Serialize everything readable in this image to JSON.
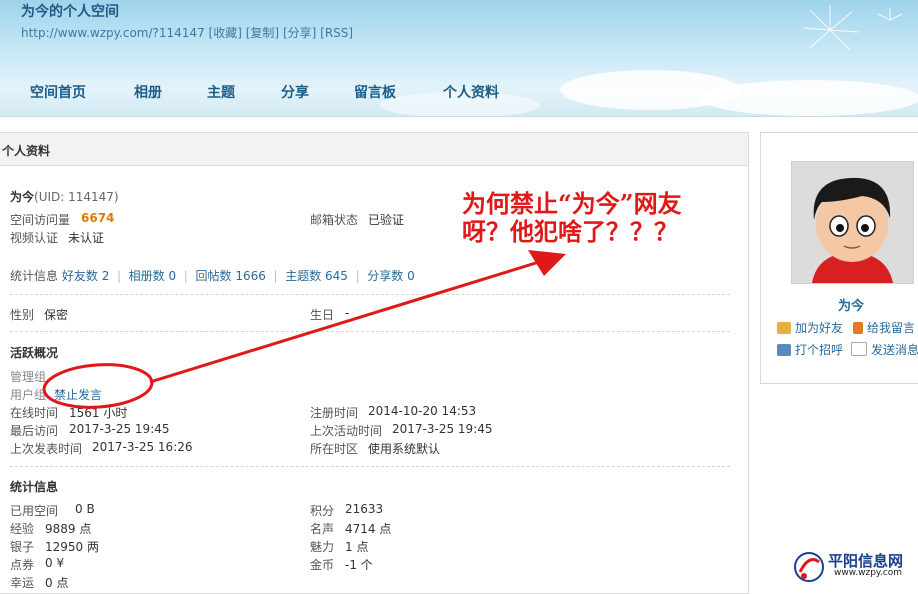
{
  "header": {
    "title": "为今的个人空间",
    "url": "http://www.wzpy.com/?114147",
    "links": [
      "[收藏]",
      "[复制]",
      "[分享]",
      "[RSS]"
    ]
  },
  "nav": [
    "空间首页",
    "相册",
    "主题",
    "分享",
    "留言板",
    "个人资料"
  ],
  "panel": {
    "title": "个人资料",
    "user_name": "为今",
    "uid": "(UID: 114147)",
    "visits_label": "空间访问量",
    "visits_value": "6674",
    "email_label": "邮箱状态",
    "email_value": "已验证",
    "video_label": "视频认证",
    "video_value": "未认证",
    "stats_label": "统计信息",
    "stats": [
      {
        "label": "好友数",
        "value": "2"
      },
      {
        "label": "相册数",
        "value": "0"
      },
      {
        "label": "回帖数",
        "value": "1666"
      },
      {
        "label": "主题数",
        "value": "645"
      },
      {
        "label": "分享数",
        "value": "0"
      }
    ],
    "gender_label": "性别",
    "gender_value": "保密",
    "birthday_label": "生日",
    "birthday_value": "-",
    "activity_title": "活跃概况",
    "admin_group_label": "管理组",
    "user_group_label": "用户组",
    "user_group_value": "禁止发言",
    "online_label": "在线时间",
    "online_value": "1561 小时",
    "reg_label": "注册时间",
    "reg_value": "2014-10-20 14:53",
    "last_visit_label": "最后访问",
    "last_visit_value": "2017-3-25 19:45",
    "last_active_label": "上次活动时间",
    "last_active_value": "2017-3-25 19:45",
    "last_post_label": "上次发表时间",
    "last_post_value": "2017-3-25 16:26",
    "tz_label": "所在时区",
    "tz_value": "使用系统默认",
    "statistics_title": "统计信息",
    "used_space_label": "已用空间",
    "used_space_value": "0 B",
    "points_label": "积分",
    "points_value": "21633",
    "exp_label": "经验",
    "exp_value": "9889 点",
    "fame_label": "名声",
    "fame_value": "4714 点",
    "silver_label": "银子",
    "silver_value": "12950 两",
    "charm_label": "魅力",
    "charm_value": "1 点",
    "coupon_label": "点券",
    "coupon_value": "0 ¥",
    "gold_label": "金币",
    "gold_value": "-1 个",
    "luck_label": "幸运",
    "luck_value": "0 点"
  },
  "sidebar": {
    "name": "为今",
    "add_friend": "加为好友",
    "leave_message": "给我留言",
    "greet": "打个招呼",
    "send_message": "发送消息"
  },
  "annotation": {
    "line1": "为何禁止“为今”网友",
    "line2": "呀？他犯啥了？？？"
  },
  "watermark": {
    "title": "平阳信息网",
    "url": "www.wzpy.com"
  },
  "colors": {
    "annotation": "#e01818",
    "link": "#2a6a9a",
    "visits": "#e07a00"
  }
}
